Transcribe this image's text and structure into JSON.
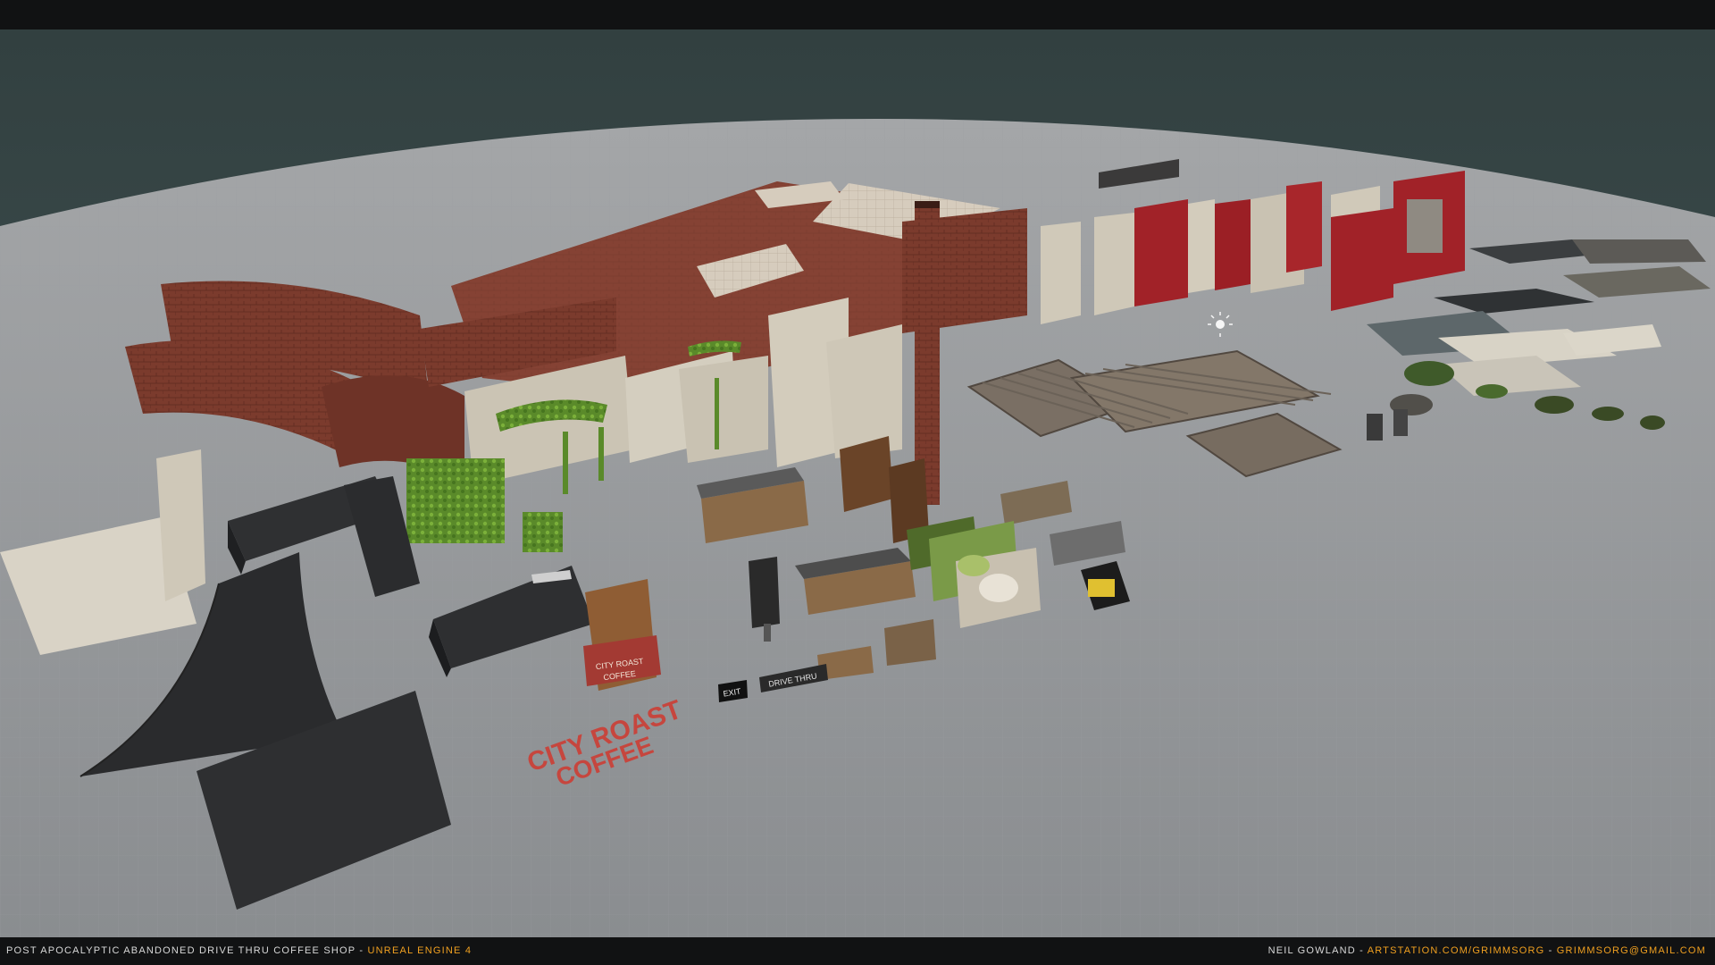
{
  "caption": {
    "project": "POST APOCALYPTIC ABANDONED DRIVE THRU COFFEE SHOP",
    "separator": " - ",
    "engine": "UNREAL ENGINE 4",
    "author": "NEIL GOWLAND",
    "site": "ARTSTATION.COM/GRIMMSORG",
    "email": "GRIMMSORG@GMAIL.COM"
  },
  "scene_labels": {
    "sign_small_line1": "CITY ROAST",
    "sign_small_line2": "COFFEE",
    "sign_big_line1": "CITY ROAST",
    "sign_big_line2": "COFFEE",
    "exit_sign": "EXIT",
    "drive_thru_sign": "DRIVE THRU"
  },
  "colors": {
    "sky": "#3c4a4a",
    "ground": "#8f9295",
    "brick": "#7a3a2c",
    "plaster": "#cfc8b8",
    "red_panel": "#a02228",
    "ivy": "#5e8f2e",
    "asphalt": "#2e2f31",
    "caption_accent": "#f0a020"
  }
}
